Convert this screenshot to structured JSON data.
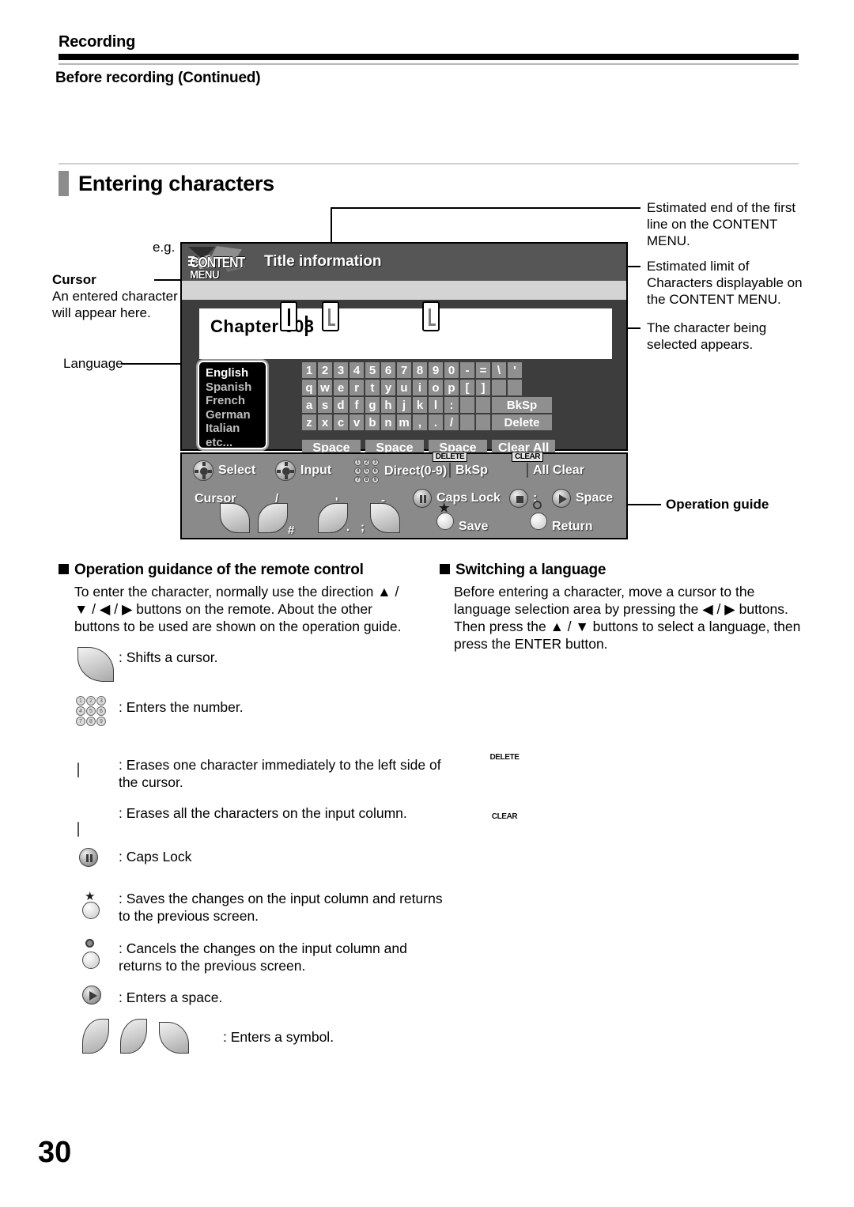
{
  "header": {
    "running_title": "Recording",
    "running_subtitle": "Before recording (Continued)"
  },
  "section": {
    "title": "Entering characters"
  },
  "figure": {
    "eg_label": "e.g.",
    "callouts": {
      "cursor_title": "Cursor",
      "cursor_body": "An entered character will appear here.",
      "language": "Language",
      "right_1": "Estimated end of the first line on the CONTENT MENU.",
      "right_2": "Estimated limit of Characters displayable on the CONTENT MENU.",
      "right_3": "The character being selected appears.",
      "operation_guide": "Operation guide"
    },
    "screen": {
      "logo_line1": "CONTENT",
      "logo_line2": "MENU",
      "title": "Title information",
      "input_value": "Chapter 003",
      "languages": [
        "English",
        "Spanish",
        "French",
        "German",
        "Italian",
        "etc..."
      ],
      "selected_language": "English",
      "keyboard": {
        "row1": [
          "1",
          "2",
          "3",
          "4",
          "5",
          "6",
          "7",
          "8",
          "9",
          "0",
          "-",
          "=",
          "\\",
          "'"
        ],
        "row2": [
          "q",
          "w",
          "e",
          "r",
          "t",
          "y",
          "u",
          "i",
          "o",
          "p",
          "[",
          "]",
          "",
          ""
        ],
        "row3": [
          "a",
          "s",
          "d",
          "f",
          "g",
          "h",
          "j",
          "k",
          "l",
          ":",
          "",
          ""
        ],
        "row3_action": "BkSp",
        "row4": [
          "z",
          "x",
          "c",
          "v",
          "b",
          "n",
          "m",
          ",",
          ".",
          "/",
          "",
          ""
        ],
        "row4_action": "Delete",
        "bottom": [
          "Space",
          "Space",
          "Space",
          "Clear All"
        ]
      }
    },
    "operation_guide_panel": {
      "select": "Select",
      "input": "Input",
      "direct": "Direct(0-9)",
      "delete_cap": "DELETE",
      "bksp": "BkSp",
      "clear_cap": "CLEAR",
      "all_clear": "All Clear",
      "cursor": "Cursor",
      "caps_lock": "Caps Lock",
      "colon": ":",
      "space": "Space",
      "save": "Save",
      "return": "Return",
      "arc_symbols": [
        "/",
        "#",
        "'",
        ".",
        ";",
        "-"
      ]
    }
  },
  "sections": {
    "left": {
      "heading": "Operation guidance of the remote control",
      "body": "To enter the character, normally use the direction ▲ / ▼ / ◀ / ▶ buttons on the remote. About the other buttons to be used are shown on the operation guide."
    },
    "right": {
      "heading": "Switching a language",
      "body": "Before entering a character, move a cursor to the language selection area by pressing the ◀ / ▶ buttons. Then press the ▲ / ▼ buttons to select a language, then press the ENTER button."
    }
  },
  "legend": [
    {
      "icon": "arc-cursor-icon",
      "text": ": Shifts a cursor."
    },
    {
      "icon": "numeric-keypad-icon",
      "text": ": Enters the number."
    },
    {
      "icon": "delete-button-icon",
      "cap": "DELETE",
      "text": ": Erases one character immediately to the left side of the cursor."
    },
    {
      "icon": "clear-button-icon",
      "cap": "CLEAR",
      "text": ": Erases all the characters on the input column."
    },
    {
      "icon": "pause-button-icon",
      "text": ": Caps Lock"
    },
    {
      "icon": "star-button-icon",
      "text": ": Saves the changes on the input column and returns to the previous screen."
    },
    {
      "icon": "return-button-icon",
      "text": ": Cancels the changes on the input column and returns to the previous screen."
    },
    {
      "icon": "play-button-icon",
      "text": ": Enters a space."
    },
    {
      "icon": "arc-symbols-icon",
      "text": ": Enters a symbol."
    }
  ],
  "footer": {
    "page_number": "30"
  }
}
